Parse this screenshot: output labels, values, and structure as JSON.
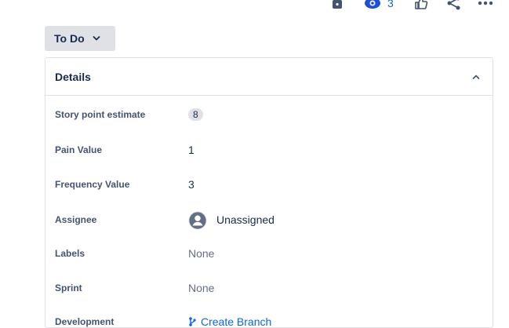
{
  "toolbar": {
    "icons": [
      "lock-icon",
      "eye-icon",
      "thumbs-up-icon",
      "share-icon",
      "more-icon"
    ],
    "watch_count": "3"
  },
  "status": {
    "label": "To Do"
  },
  "details": {
    "title": "Details",
    "fields": [
      {
        "label": "Story point estimate",
        "value": "8"
      },
      {
        "label": "Pain Value",
        "value": "1"
      },
      {
        "label": "Frequency Value",
        "value": "3"
      },
      {
        "label": "Assignee",
        "value": "Unassigned"
      },
      {
        "label": "Labels",
        "value": "None"
      },
      {
        "label": "Sprint",
        "value": "None"
      },
      {
        "label": "Development",
        "value": "Create Branch"
      }
    ]
  },
  "colors": {
    "link": "#0c66e4",
    "status_bg": "#dfe1e6",
    "text": "#172b4d",
    "label": "#44546f"
  }
}
